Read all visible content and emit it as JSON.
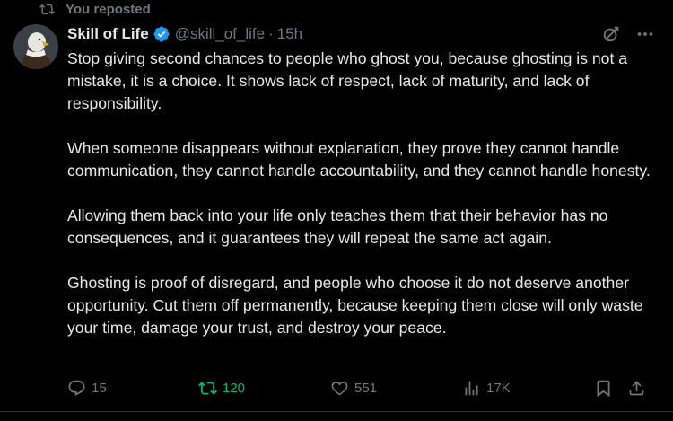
{
  "repost_banner": {
    "text": "You reposted"
  },
  "author": {
    "name": "Skill of Life",
    "handle": "@skill_of_life",
    "separator": "·",
    "time": "15h",
    "verified": true
  },
  "post": {
    "paragraphs": [
      "Stop giving second chances to people who ghost you, because ghosting is not a mistake, it is a choice. It shows lack of respect, lack of maturity, and lack of responsibility.",
      "When someone disappears without explanation, they prove they cannot handle communication, they cannot handle accountability, and they cannot handle honesty.",
      "Allowing them back into your life only teaches them that their behavior has no consequences, and it guarantees they will repeat the same act again.",
      "Ghosting is proof of disregard, and people who choose it do not deserve another opportunity. Cut them off permanently, because keeping them close will only waste your time, damage your trust, and destroy your peace."
    ]
  },
  "actions": {
    "replies": "15",
    "reposts": "120",
    "likes": "551",
    "views": "17K"
  },
  "colors": {
    "background": "#000000",
    "text": "#e7e9ea",
    "muted": "#71767b",
    "verified": "#1d9bf0",
    "repost_active": "#00ba7c"
  }
}
